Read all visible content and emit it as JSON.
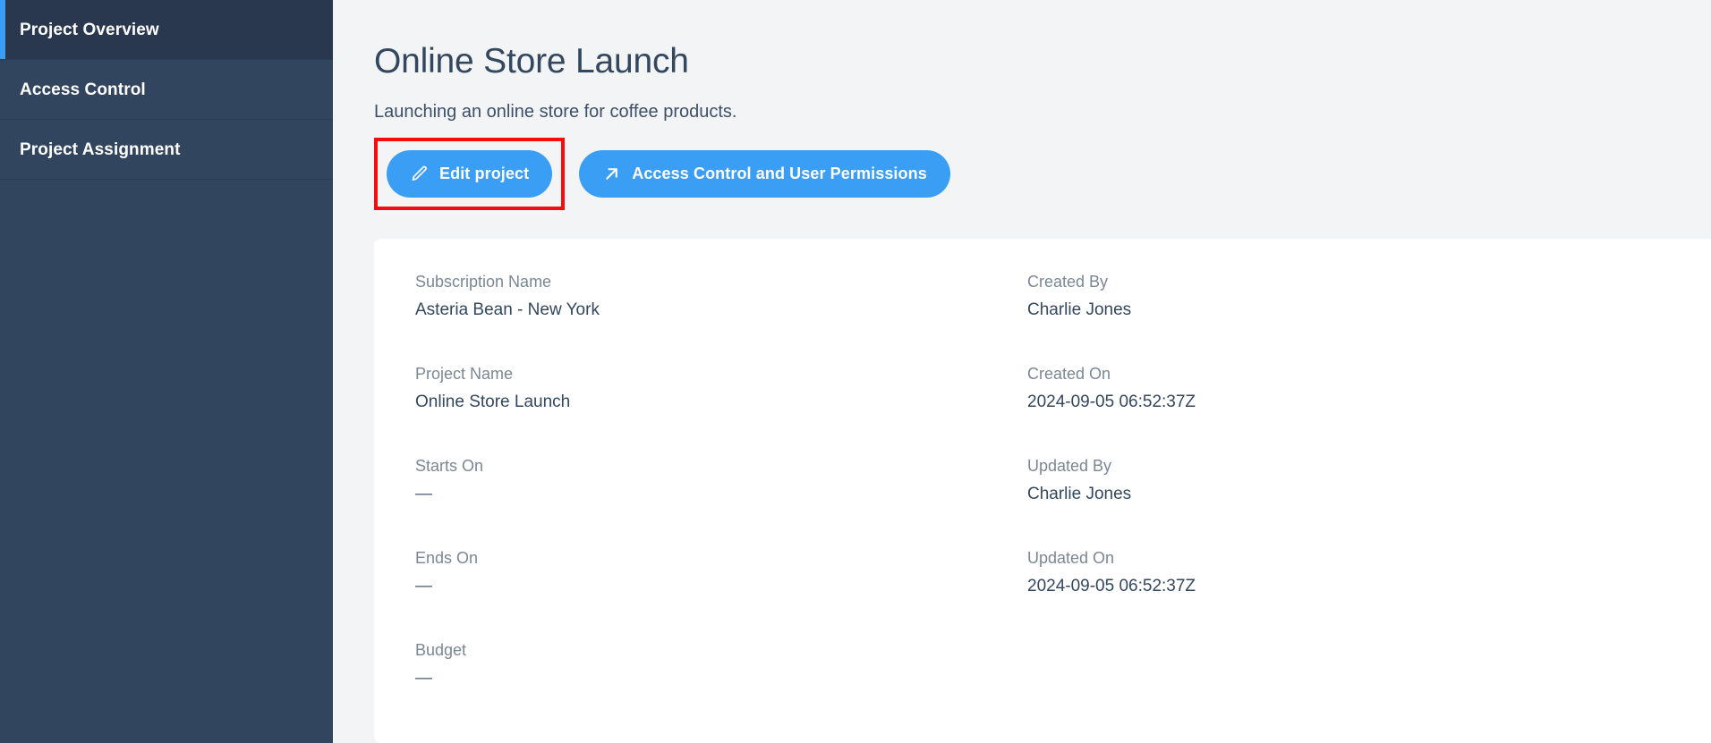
{
  "theme": {
    "sidebar_bg": "#32455f",
    "sidebar_active_bg": "#29384f",
    "accent_blue": "#3b9ef5",
    "highlight_red": "#f50c0c",
    "page_bg": "#f2f4f6",
    "card_bg": "#ffffff",
    "text_dark": "#33475e",
    "label_gray": "#7b8794"
  },
  "sidebar": {
    "items": [
      {
        "label": "Project Overview",
        "active": true
      },
      {
        "label": "Access Control",
        "active": false
      },
      {
        "label": "Project Assignment",
        "active": false
      }
    ]
  },
  "header": {
    "title": "Online Store Launch",
    "subtitle": "Launching an online store for coffee products."
  },
  "actions": {
    "edit_project": {
      "label": "Edit project",
      "icon": "pencil-icon"
    },
    "access_control": {
      "label": "Access Control and User Permissions",
      "icon": "external-link-icon"
    }
  },
  "details": {
    "left": [
      {
        "label": "Subscription Name",
        "value": "Asteria Bean - New York"
      },
      {
        "label": "Project Name",
        "value": "Online Store Launch"
      },
      {
        "label": "Starts On",
        "value": "—"
      },
      {
        "label": "Ends On",
        "value": "—"
      },
      {
        "label": "Budget",
        "value": "—"
      }
    ],
    "right": [
      {
        "label": "Created By",
        "value": "Charlie Jones"
      },
      {
        "label": "Created On",
        "value": "2024-09-05 06:52:37Z"
      },
      {
        "label": "Updated By",
        "value": "Charlie Jones"
      },
      {
        "label": "Updated On",
        "value": "2024-09-05 06:52:37Z"
      },
      {
        "label": "",
        "value": ""
      }
    ]
  }
}
